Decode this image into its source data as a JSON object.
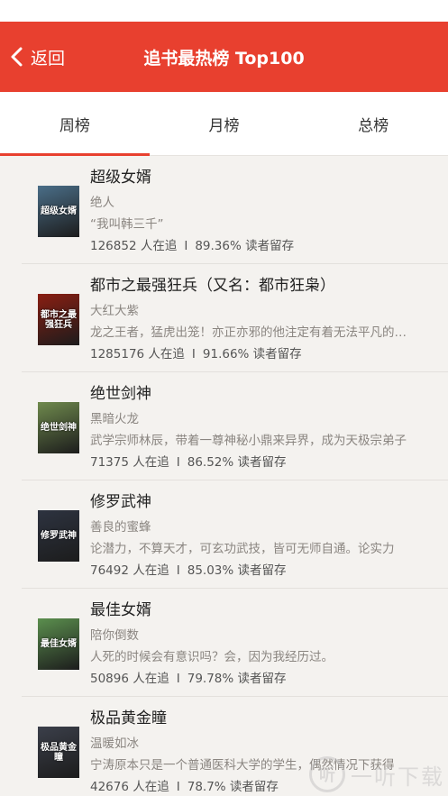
{
  "header": {
    "back_label": "返回",
    "title": "追书最热榜 Top100"
  },
  "tabs": [
    {
      "label": "周榜",
      "active": true
    },
    {
      "label": "月榜",
      "active": false
    },
    {
      "label": "总榜",
      "active": false
    }
  ],
  "books": [
    {
      "title": "超级女婿",
      "author": "绝人",
      "desc": "“我叫韩三千”",
      "readers": "126852 人在追",
      "retention": "89.36% 读者留存",
      "cover_text": "超级女婿",
      "cover_color": "#4a6e88"
    },
    {
      "title": "都市之最强狂兵（又名：都市狂枭）",
      "author": "大红大紫",
      "desc": "龙之王者，猛虎出笼！亦正亦邪的他注定有着无法平凡的一生",
      "readers": "1285176 人在追",
      "retention": "91.66% 读者留存",
      "cover_text": "都市之最强狂兵",
      "cover_color": "#8a1e12"
    },
    {
      "title": "绝世剑神",
      "author": "黑暗火龙",
      "desc": "武学宗师林辰，带着一尊神秘小鼎来异界，成为天极宗弟子",
      "readers": "71375 人在追",
      "retention": "86.52% 读者留存",
      "cover_text": "绝世剑神",
      "cover_color": "#6f8a4d"
    },
    {
      "title": "修罗武神",
      "author": "善良的蜜蜂",
      "desc": "论潜力，不算天才，可玄功武技，皆可无师自通。论实力",
      "readers": "76492 人在追",
      "retention": "85.03% 读者留存",
      "cover_text": "修罗武神",
      "cover_color": "#2d3340"
    },
    {
      "title": "最佳女婿",
      "author": "陪你倒数",
      "desc": "人死的时候会有意识吗？会，因为我经历过。",
      "readers": "50896 人在追",
      "retention": "79.78% 读者留存",
      "cover_text": "最佳女婿",
      "cover_color": "#5b8f4e"
    },
    {
      "title": "极品黄金瞳",
      "author": "温暖如冰",
      "desc": "宁涛原本只是一个普通医科大学的学生，偶然情况下获得",
      "readers": "42676 人在追",
      "retention": "78.7% 读者留存",
      "cover_text": "极品黄金瞳",
      "cover_color": "#3b3f4a"
    }
  ],
  "separator": "I",
  "watermark": {
    "logo_text": "听",
    "text": "一听下载"
  }
}
